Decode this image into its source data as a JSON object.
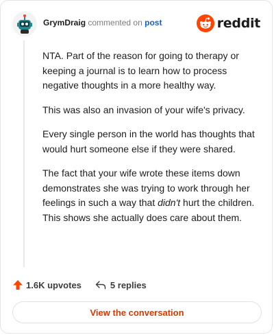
{
  "header": {
    "author": "GrymDraig",
    "action": "commented on",
    "post_link": "post",
    "brand": "reddit"
  },
  "comment": {
    "paragraphs": [
      {
        "text": "NTA. Part of the reason for going to therapy or keeping a journal is to learn how to process negative thoughts in a more healthy way."
      },
      {
        "text": "This was also an invasion of your wife's privacy."
      },
      {
        "text": "Every single person in the world has thoughts that would hurt someone else if they were shared."
      },
      {
        "pre": "The fact that your wife wrote these items down demonstrates she was trying to work through her feelings in such a way that ",
        "em": "didn't",
        "post": " hurt the children. This shows she actually does care about them."
      }
    ]
  },
  "footer": {
    "upvotes": "1.6K upvotes",
    "replies": "5 replies"
  },
  "cta": {
    "label": "View the conversation"
  },
  "colors": {
    "accent": "#d93900",
    "upvote": "#ff4500",
    "link": "#1a5fc2"
  },
  "icons": {
    "avatar": "robot-avatar-icon",
    "brand": "reddit-logo-icon",
    "upvote": "upvote-arrow-icon",
    "reply": "reply-arrow-icon"
  }
}
